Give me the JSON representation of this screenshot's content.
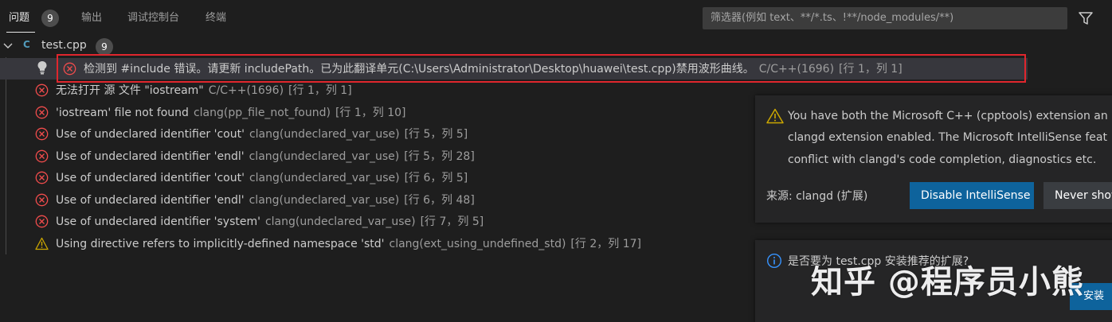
{
  "panel": {
    "tabs": [
      {
        "label": "问题",
        "count": "9"
      },
      {
        "label": "输出"
      },
      {
        "label": "调试控制台"
      },
      {
        "label": "终端"
      }
    ],
    "filter_placeholder": "筛选器(例如 text、**/*.ts、!**/node_modules/**)"
  },
  "file": {
    "icon": "C",
    "name": "test.cpp",
    "count": "9"
  },
  "problems": [
    {
      "severity": "error",
      "msg": "检测到 #include 错误。请更新 includePath。已为此翻译单元(C:\\Users\\Administrator\\Desktop\\huawei\\test.cpp)禁用波形曲线。",
      "src": "C/C++(1696)",
      "pos": "[行 1，列 1]"
    },
    {
      "severity": "error",
      "msg": "无法打开 源 文件 \"iostream\"",
      "src": "C/C++(1696)",
      "pos": "[行 1，列 1]"
    },
    {
      "severity": "error",
      "msg": "'iostream' file not found",
      "src": "clang(pp_file_not_found)",
      "pos": "[行 1，列 10]"
    },
    {
      "severity": "error",
      "msg": "Use of undeclared identifier 'cout'",
      "src": "clang(undeclared_var_use)",
      "pos": "[行 5，列 5]"
    },
    {
      "severity": "error",
      "msg": "Use of undeclared identifier 'endl'",
      "src": "clang(undeclared_var_use)",
      "pos": "[行 5，列 28]"
    },
    {
      "severity": "error",
      "msg": "Use of undeclared identifier 'cout'",
      "src": "clang(undeclared_var_use)",
      "pos": "[行 6，列 5]"
    },
    {
      "severity": "error",
      "msg": "Use of undeclared identifier 'endl'",
      "src": "clang(undeclared_var_use)",
      "pos": "[行 6，列 48]"
    },
    {
      "severity": "error",
      "msg": "Use of undeclared identifier 'system'",
      "src": "clang(undeclared_var_use)",
      "pos": "[行 7，列 5]"
    },
    {
      "severity": "warning",
      "msg": "Using directive refers to implicitly-defined namespace 'std'",
      "src": "clang(ext_using_undefined_std)",
      "pos": "[行 2，列 17]"
    }
  ],
  "notification": {
    "lines": [
      "You have both the Microsoft C++ (cpptools) extension an",
      "clangd extension enabled. The Microsoft IntelliSense feat",
      "conflict with clangd's code completion, diagnostics etc."
    ],
    "source": "来源: clangd (扩展)",
    "primary_button": "Disable IntelliSense",
    "secondary_button": "Never show"
  },
  "notification2": {
    "text": "是否要为 test.cpp 安装推荐的扩展?",
    "button": "安装"
  },
  "watermark": "知乎 @程序员小熊",
  "colors": {
    "error": "#f14c4c",
    "warning": "#cca700",
    "info": "#3794ff",
    "accent": "#0e639c",
    "highlight": "#e0262d"
  }
}
